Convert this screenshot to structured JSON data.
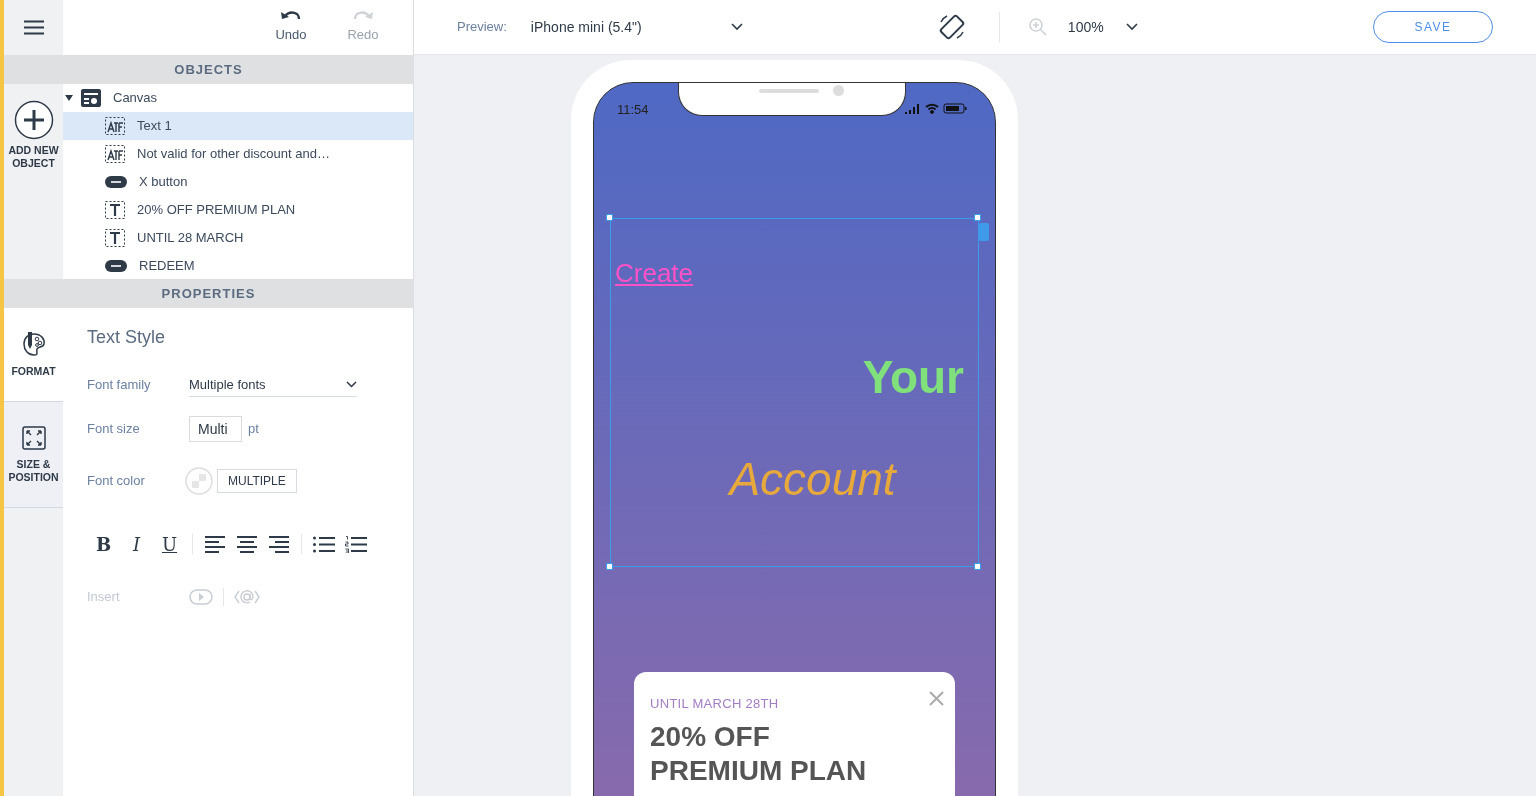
{
  "history_buttons": [
    {
      "label": "Undo",
      "kind": "undo",
      "disabled": false
    },
    {
      "label": "Redo",
      "kind": "redo",
      "disabled": true
    }
  ],
  "objects_panel": {
    "title": "OBJECTS",
    "add_button": "ADD NEW OBJECT",
    "tree": [
      {
        "label": "Canvas",
        "kind": "canvas",
        "expanded": true,
        "selected": false,
        "children": [
          {
            "label": "Text 1",
            "kind": "rich-text",
            "selected": true
          },
          {
            "label": "Not valid for other discount and…",
            "kind": "rich-text",
            "selected": false
          },
          {
            "label": "X button",
            "kind": "button",
            "selected": false
          },
          {
            "label": "20% OFF PREMIUM PLAN",
            "kind": "text",
            "selected": false
          },
          {
            "label": "UNTIL 28 MARCH",
            "kind": "text",
            "selected": false
          },
          {
            "label": "REDEEM",
            "kind": "button",
            "selected": false
          }
        ]
      }
    ]
  },
  "properties_panel": {
    "title": "PROPERTIES",
    "tabs": [
      {
        "label": "FORMAT",
        "kind": "format",
        "selected": true
      },
      {
        "label": "SIZE & POSITION",
        "kind": "size",
        "selected": false
      }
    ],
    "section_title": "Text Style",
    "font_family": {
      "label": "Font family",
      "value": "Multiple fonts"
    },
    "font_size": {
      "label": "Font size",
      "value": "Multi",
      "unit": "pt"
    },
    "font_color": {
      "label": "Font color",
      "value": "MULTIPLE"
    },
    "style_buttons": [
      {
        "label": "B",
        "kind": "bold"
      },
      {
        "label": "I",
        "kind": "italic"
      },
      {
        "label": "U",
        "kind": "underline"
      }
    ],
    "insert": {
      "label": "Insert",
      "disabled": true
    }
  },
  "top_bar": {
    "preview_label": "Preview:",
    "device": "iPhone mini (5.4\")",
    "zoom": "100%",
    "save": "SAVE"
  },
  "phone": {
    "time": "11:54",
    "text_block": {
      "selected": true,
      "lines": [
        {
          "text": "Create",
          "kind": "link",
          "color": "#ff52c8"
        },
        {
          "text": "Your",
          "kind": "bold",
          "color": "#7fe07c"
        },
        {
          "text": "Account",
          "kind": "italic",
          "color": "#e7a93c"
        }
      ]
    },
    "popup": {
      "eyebrow": "UNTIL MARCH 28TH",
      "headline": [
        "20% OFF",
        "PREMIUM PLAN"
      ]
    }
  }
}
